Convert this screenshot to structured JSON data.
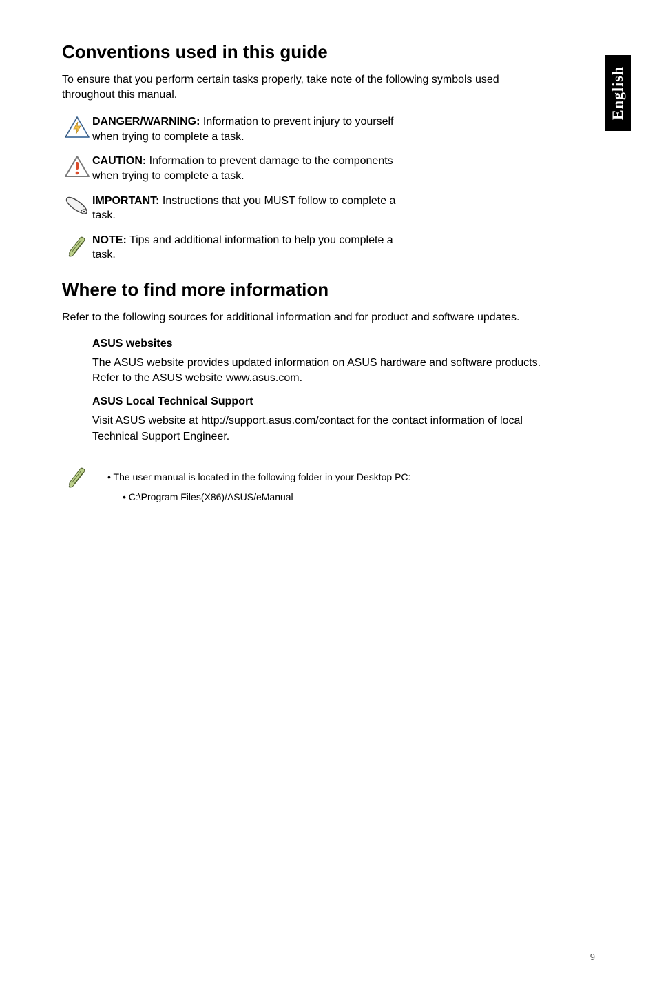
{
  "sideTab": "English",
  "heading1": "Conventions used in this guide",
  "intro1": "To ensure that you perform certain tasks properly, take note of the following symbols used throughout this manual.",
  "warnings": [
    {
      "label": "DANGER/WARNING:",
      "text": " Information to prevent injury to yourself when trying to complete a task."
    },
    {
      "label": "CAUTION:",
      "text": " Information to prevent damage to the components when trying to complete a task."
    },
    {
      "label": "IMPORTANT:",
      "text": " Instructions that you MUST follow to complete a task."
    },
    {
      "label": "NOTE:",
      "text": " Tips and additional information to help you complete a task."
    }
  ],
  "heading2": "Where to find more information",
  "intro2": "Refer to the following sources for additional information and for product and software updates.",
  "asusWeb": {
    "title": "ASUS websites",
    "pre": "The ASUS website provides updated information on ASUS hardware and software products. Refer to the ASUS website ",
    "link": "www.asus.com",
    "post": "."
  },
  "asusSupport": {
    "title": "ASUS Local Technical Support",
    "pre": "Visit ASUS website at ",
    "link": "http://support.asus.com/contact",
    "post": " for the contact information of local Technical Support Engineer."
  },
  "note": {
    "line1": "The user manual is located in the following folder in your Desktop PC:",
    "line2": "C:\\Program Files(X86)/ASUS/eManual"
  },
  "pageNumber": "9"
}
